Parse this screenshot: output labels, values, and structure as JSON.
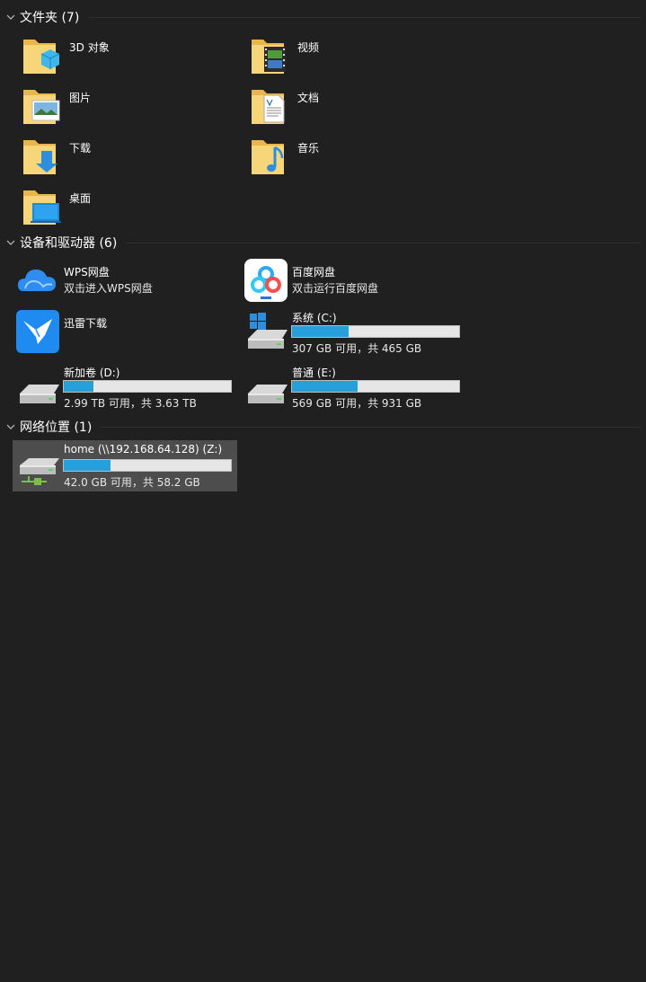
{
  "groups": {
    "folders": {
      "title": "文件夹 (7)"
    },
    "devices": {
      "title": "设备和驱动器 (6)"
    },
    "network": {
      "title": "网络位置 (1)"
    }
  },
  "folders": [
    {
      "label": "3D 对象",
      "icon": "folder-3d-objects-icon"
    },
    {
      "label": "视频",
      "icon": "folder-videos-icon"
    },
    {
      "label": "图片",
      "icon": "folder-pictures-icon"
    },
    {
      "label": "文档",
      "icon": "folder-documents-icon"
    },
    {
      "label": "下载",
      "icon": "folder-downloads-icon"
    },
    {
      "label": "音乐",
      "icon": "folder-music-icon"
    },
    {
      "label": "桌面",
      "icon": "folder-desktop-icon"
    }
  ],
  "devices": {
    "wps": {
      "label": "WPS网盘",
      "sub": "双击进入WPS网盘",
      "icon": "wps-cloud-icon"
    },
    "baidu": {
      "label": "百度网盘",
      "sub": "双击运行百度网盘",
      "icon": "baidu-netdisk-icon"
    },
    "xunlei": {
      "label": "迅雷下载",
      "icon": "xunlei-bird-icon"
    },
    "c": {
      "label": "系统 (C:)",
      "sub": "307 GB 可用，共 465 GB",
      "used_fraction": 0.34,
      "icon": "windows-drive-icon"
    },
    "d": {
      "label": "新加卷 (D:)",
      "sub": "2.99 TB 可用，共 3.63 TB",
      "used_fraction": 0.18,
      "icon": "hard-drive-icon"
    },
    "e": {
      "label": "普通 (E:)",
      "sub": "569 GB 可用，共 931 GB",
      "used_fraction": 0.39,
      "icon": "hard-drive-icon"
    }
  },
  "network": {
    "z": {
      "label": "home (\\\\192.168.64.128) (Z:)",
      "sub": "42.0 GB 可用，共 58.2 GB",
      "used_fraction": 0.28,
      "icon": "network-drive-icon"
    }
  },
  "colors": {
    "background": "#202020",
    "bar_fill": "#26a0da",
    "bar_track": "#e6e6e6",
    "selected": "#4d4d4d"
  }
}
